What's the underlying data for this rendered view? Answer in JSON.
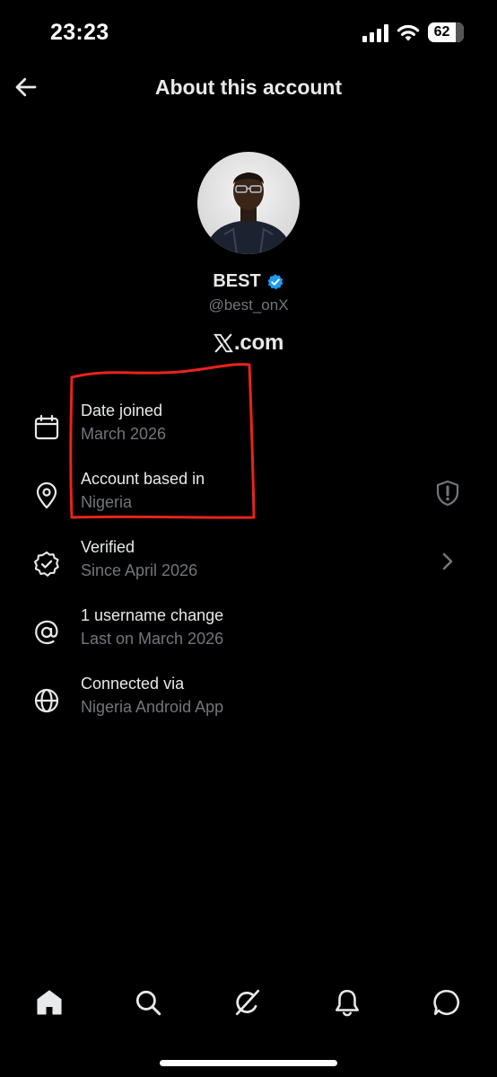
{
  "status_bar": {
    "time": "23:23",
    "battery_level": "62",
    "battery_fraction": 0.62
  },
  "header": {
    "title": "About this account",
    "back_icon": "arrow-left-icon"
  },
  "profile": {
    "display_name": "BEST",
    "handle": "@best_onX",
    "verified_color": "#1d9bf0",
    "platform": ".com",
    "platform_logo": "x-logo-icon"
  },
  "rows": [
    {
      "icon": "calendar-icon",
      "title": "Date joined",
      "subtitle": "March 2026"
    },
    {
      "icon": "location-pin-icon",
      "title": "Account based in",
      "subtitle": "Nigeria",
      "trailing": "shield-alert-icon"
    },
    {
      "icon": "verified-badge-outline-icon",
      "title": "Verified",
      "subtitle": "Since April 2026",
      "trailing": "chevron-right-icon"
    },
    {
      "icon": "at-sign-icon",
      "title": "1 username change",
      "subtitle": "Last on March 2026"
    },
    {
      "icon": "globe-icon",
      "title": "Connected via",
      "subtitle": "Nigeria Android App"
    }
  ],
  "annotation_color": "#e8231c",
  "bottom_nav": [
    "home-icon",
    "search-icon",
    "grok-icon",
    "bell-icon",
    "messages-icon"
  ],
  "colors": {
    "background": "#000000",
    "primary_text": "#e7e9ea",
    "secondary_text": "#71767b"
  }
}
